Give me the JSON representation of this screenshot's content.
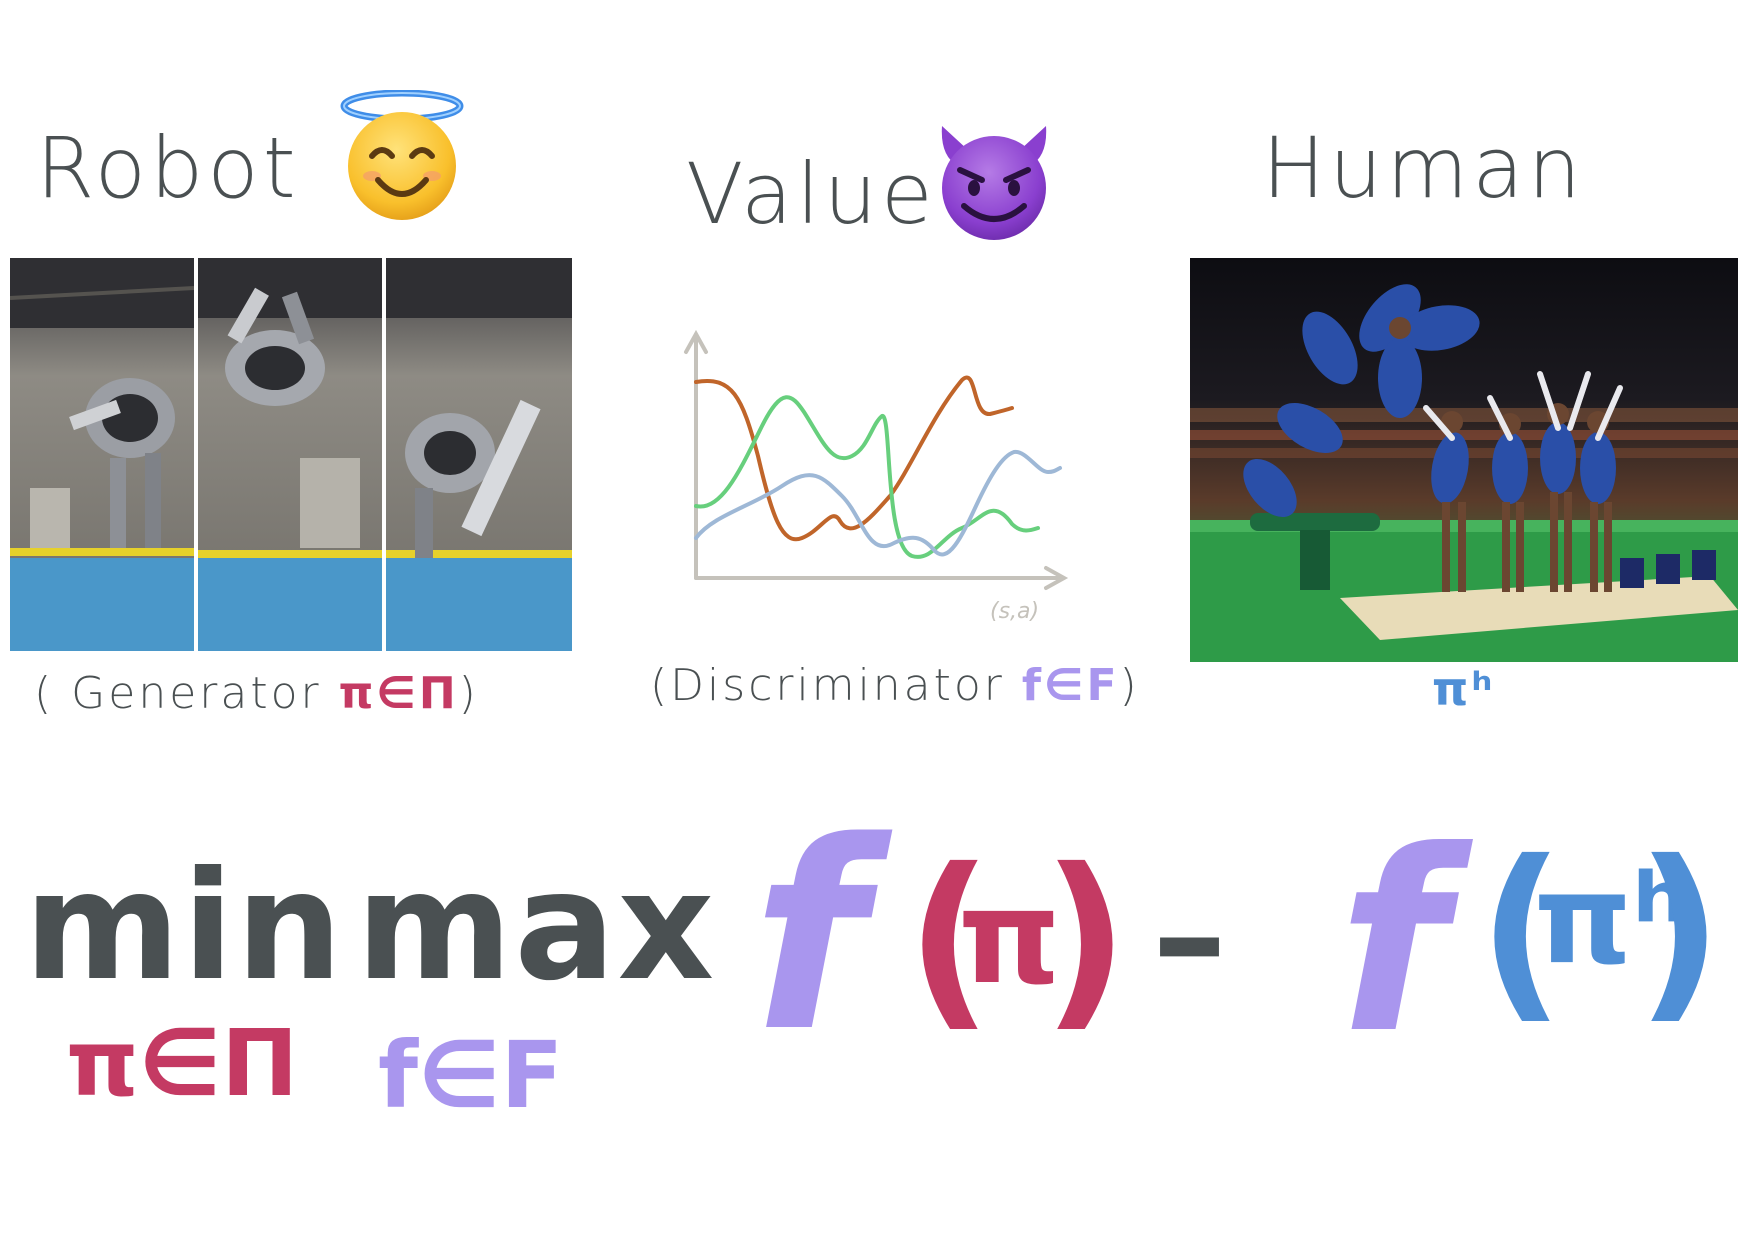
{
  "sections": {
    "robot": {
      "title": "Robot",
      "caption_pre": "( Generator ",
      "caption_math": "π∈Π",
      "caption_post": ")"
    },
    "value": {
      "title": "Value",
      "caption_pre": "(Discriminator ",
      "caption_math": "f∈F",
      "caption_post": ")",
      "axis_label": "(s,a)"
    },
    "human": {
      "title": "Human",
      "caption_math": "πʰ"
    }
  },
  "formula": {
    "min": "min",
    "min_sub": "π∈Π",
    "max": "max",
    "max_sub": "f∈F",
    "f1": "f",
    "open1": "(",
    "arg1": "π",
    "close1": ")",
    "minus": "–",
    "f2": "f",
    "open2": "(",
    "arg2": "πʰ",
    "close2": ")"
  },
  "colors": {
    "ink": "#4a5052",
    "crimson": "#c43a63",
    "lavender": "#a996ee",
    "blue": "#4f8fd6",
    "orange": "#c0652a",
    "green": "#67cf7d",
    "lightblue": "#9eb8d6",
    "axis": "#c5c2bb"
  },
  "icons": {
    "robot_emoji": "smiling-face-with-halo-icon",
    "value_emoji": "smiling-face-with-horns-icon"
  }
}
